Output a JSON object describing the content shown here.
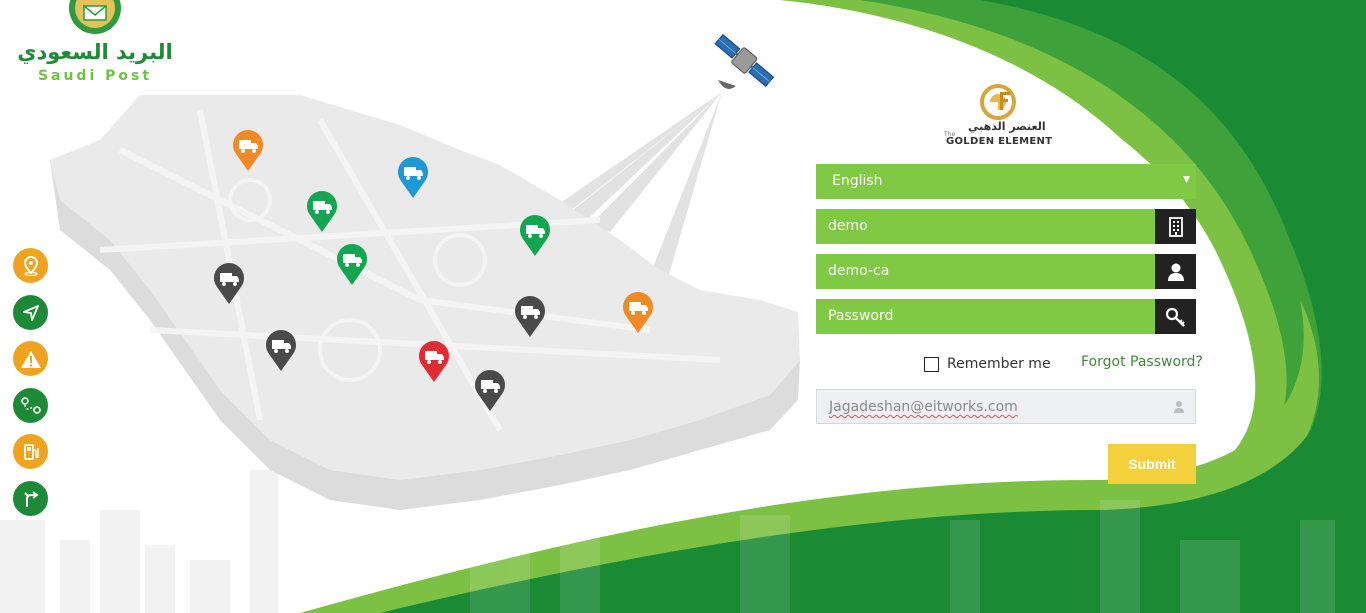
{
  "brand": {
    "arabic_name": "البريد السعودي",
    "latin_name": "Saudi Post"
  },
  "partner": {
    "prefix": "The",
    "arabic_name": "العنصر الذهبي",
    "latin_name": "GOLDEN ELEMENT"
  },
  "side_menu": [
    {
      "icon": "map-pin-icon",
      "color": "#f0a31f"
    },
    {
      "icon": "navigation-arrow-icon",
      "color": "#1c8a36"
    },
    {
      "icon": "warning-icon",
      "color": "#f0a31f"
    },
    {
      "icon": "route-icon",
      "color": "#1c8a36"
    },
    {
      "icon": "fuel-pump-icon",
      "color": "#f0a31f"
    },
    {
      "icon": "turn-direction-icon",
      "color": "#1c8a36"
    }
  ],
  "map": {
    "pin_colors": {
      "orange": "#f08a24",
      "blue": "#1d9ad6",
      "green": "#13a54f",
      "dark": "#4a4a4a",
      "red": "#e02b34"
    }
  },
  "form": {
    "language": "English",
    "company": "demo",
    "username": "demo-ca",
    "password_placeholder": "Password",
    "remember_label": "Remember me",
    "forgot_label": "Forgot Password?",
    "email_value": "Jagadeshan@eitworks.com",
    "submit_label": "Submit"
  },
  "colors": {
    "field_green": "#80c944",
    "dark_green": "#1a8a35",
    "light_green": "#7cc143",
    "submit_yellow": "#f5d03d",
    "icon_dark": "#222222"
  }
}
